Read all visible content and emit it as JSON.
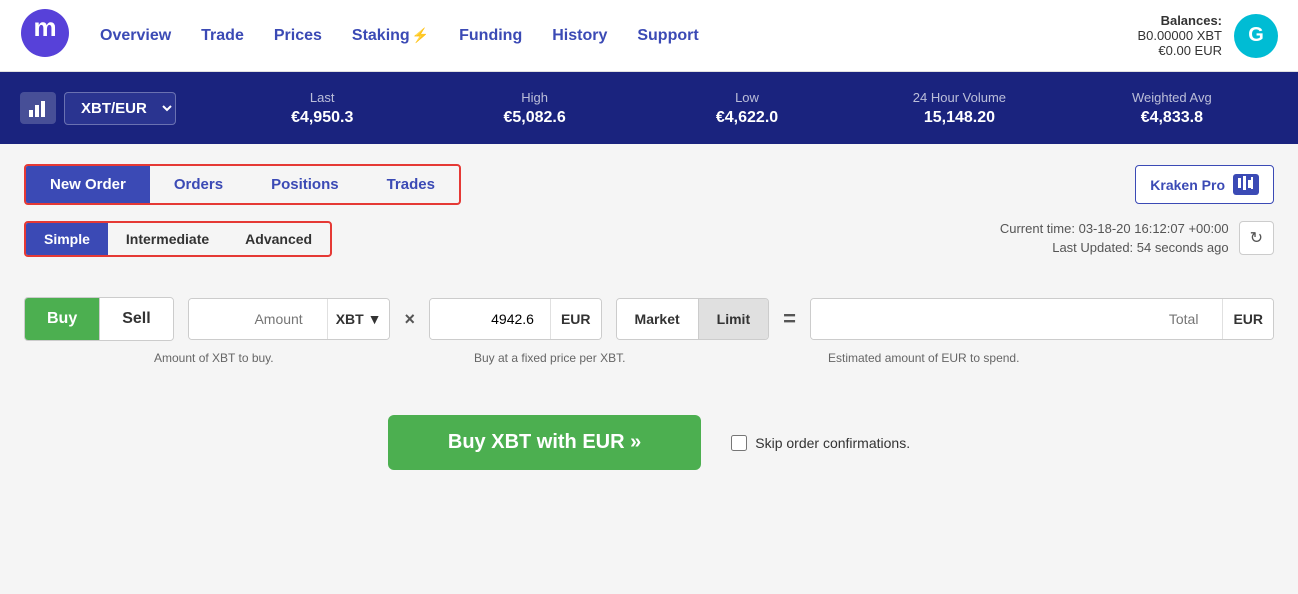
{
  "nav": {
    "links": [
      "Overview",
      "Trade",
      "Prices",
      "Staking",
      "Funding",
      "History",
      "Support"
    ],
    "staking_index": 3,
    "balances_label": "Balances:",
    "balance_xbt": "B0.00000 XBT",
    "balance_eur": "€0.00 EUR",
    "avatar_letter": "G"
  },
  "ticker": {
    "pair": "XBT/EUR",
    "last_label": "Last",
    "last_value": "€4,950.3",
    "high_label": "High",
    "high_value": "€5,082.6",
    "low_label": "Low",
    "low_value": "€4,622.0",
    "volume_label": "24 Hour Volume",
    "volume_value": "15,148.20",
    "wavg_label": "Weighted Avg",
    "wavg_value": "€4,833.8"
  },
  "tabs": {
    "items": [
      "New Order",
      "Orders",
      "Positions",
      "Trades"
    ],
    "active": 0,
    "kraken_pro_label": "Kraken Pro"
  },
  "mode_tabs": {
    "items": [
      "Simple",
      "Intermediate",
      "Advanced"
    ],
    "active": 0
  },
  "time": {
    "current_label": "Current time:",
    "current_value": "03-18-20 16:12:07 +00:00",
    "updated_label": "Last Updated:",
    "updated_value": "54 seconds ago"
  },
  "order_form": {
    "buy_label": "Buy",
    "sell_label": "Sell",
    "amount_placeholder": "Amount",
    "amount_currency": "XBT",
    "price_value": "4942.6",
    "price_currency": "EUR",
    "order_types": [
      "Market",
      "Limit"
    ],
    "active_order_type": 1,
    "total_placeholder": "Total",
    "total_currency": "EUR",
    "hint_amount": "Amount of XBT to buy.",
    "hint_price": "Buy at a fixed price per XBT.",
    "hint_total": "Estimated amount of EUR to spend.",
    "buy_submit_label": "Buy XBT with EUR »",
    "skip_confirm_label": "Skip order confirmations."
  }
}
